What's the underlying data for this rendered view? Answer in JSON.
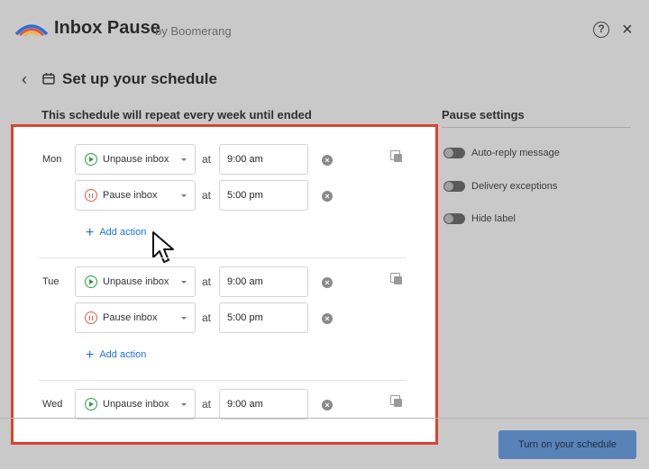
{
  "app": {
    "title": "Inbox Pause",
    "by": "by Boomerang"
  },
  "header": {
    "help_icon": "help-circle-icon",
    "close_icon": "close-icon"
  },
  "page": {
    "title": "Set up your schedule",
    "subtitle": "This schedule will repeat every week until ended"
  },
  "schedule": {
    "days": [
      {
        "day": "Mon",
        "actions": [
          {
            "action": "Unpause inbox",
            "at": "at",
            "time": "9:00 am"
          },
          {
            "action": "Pause inbox",
            "at": "at",
            "time": "5:00 pm"
          }
        ],
        "add_action": "Add action"
      },
      {
        "day": "Tue",
        "actions": [
          {
            "action": "Unpause inbox",
            "at": "at",
            "time": "9:00 am"
          },
          {
            "action": "Pause inbox",
            "at": "at",
            "time": "5:00 pm"
          }
        ],
        "add_action": "Add action"
      },
      {
        "day": "Wed",
        "actions": [
          {
            "action": "Unpause inbox",
            "at": "at",
            "time": "9:00 am"
          }
        ]
      }
    ]
  },
  "pause_settings": {
    "title": "Pause settings",
    "items": [
      {
        "label": "Auto-reply message",
        "on": false
      },
      {
        "label": "Delivery exceptions",
        "on": false
      },
      {
        "label": "Hide label",
        "on": false
      }
    ]
  },
  "footer": {
    "cta_label": "Turn on your schedule"
  },
  "colors": {
    "highlight_border": "#d9442e",
    "link_blue": "#1a73e8",
    "unpause_green": "#2e9e47",
    "pause_red": "#e05d4f",
    "cta_blue": "#5883b8"
  }
}
